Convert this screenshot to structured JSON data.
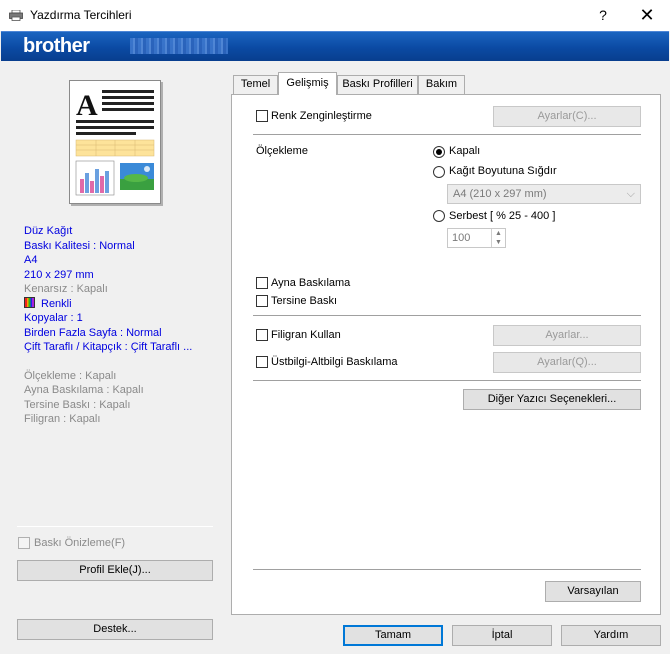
{
  "window": {
    "title": "Yazdırma Tercihleri",
    "help": "?",
    "close": "✕",
    "brand": "brother"
  },
  "left": {
    "summary": [
      {
        "text": "Düz Kağıt",
        "style": "blue"
      },
      {
        "text": "Baskı Kalitesi : Normal",
        "style": "blue"
      },
      {
        "text": "A4",
        "style": "blue"
      },
      {
        "text": "210 x 297 mm",
        "style": "blue"
      },
      {
        "text": "Kenarsız : Kapalı",
        "style": "gray"
      }
    ],
    "color_label": "Renkli",
    "summary2": [
      {
        "text": "Kopyalar : 1",
        "style": "blue"
      },
      {
        "text": "Birden Fazla Sayfa : Normal",
        "style": "blue"
      },
      {
        "text": "Çift Taraflı / Kitapçık : Çift Taraflı ...",
        "style": "blue"
      }
    ],
    "summary3": [
      {
        "text": "Ölçekleme : Kapalı"
      },
      {
        "text": "Ayna Baskılama : Kapalı"
      },
      {
        "text": "Tersine Baskı : Kapalı"
      },
      {
        "text": "Filigran : Kapalı"
      }
    ],
    "preview_checkbox": "Baskı Önizleme(F)",
    "add_profile_button": "Profil Ekle(J)...",
    "support_button": "Destek..."
  },
  "tabs": [
    {
      "label": "Temel"
    },
    {
      "label": "Gelişmiş"
    },
    {
      "label": "Baskı Profilleri"
    },
    {
      "label": "Bakım"
    }
  ],
  "advanced": {
    "color_enhance": "Renk Zenginleştirme",
    "color_settings_button": "Ayarlar(C)...",
    "scaling_label": "Ölçekleme",
    "scaling_off": "Kapalı",
    "scaling_fit": "Kağıt Boyutuna Sığdır",
    "paper_size": "A4 (210 x 297 mm)",
    "scaling_free": "Serbest [ % 25 - 400 ]",
    "scale_value": "100",
    "mirror": "Ayna Baskılama",
    "reverse": "Tersine Baskı",
    "watermark": "Filigran Kullan",
    "watermark_settings_button": "Ayarlar...",
    "header_footer": "Üstbilgi-Altbilgi Baskılama",
    "header_settings_button": "Ayarlar(Q)...",
    "other_options_button": "Diğer Yazıcı Seçenekleri...",
    "default_button": "Varsayılan"
  },
  "footer": {
    "ok": "Tamam",
    "cancel": "İptal",
    "help": "Yardım"
  }
}
